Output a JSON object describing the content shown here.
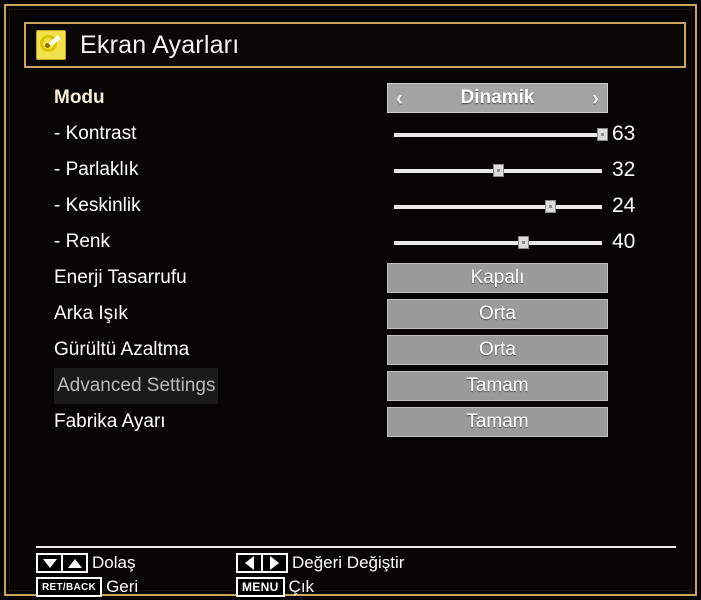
{
  "window": {
    "title": "Ekran Ayarları",
    "title_icon": "picture-settings-icon",
    "border_color": "#c9a45c",
    "background_color": "#070504"
  },
  "menu": {
    "rows": [
      {
        "label": "Modu",
        "control": "selector",
        "value": "Dinamik",
        "selected": true,
        "left_chevron": "‹",
        "right_chevron": "›",
        "name": "mode"
      },
      {
        "label": "- Kontrast",
        "control": "slider",
        "value": "63",
        "percent": 100,
        "sub": true,
        "name": "contrast"
      },
      {
        "label": "- Parlaklık",
        "control": "slider",
        "value": "32",
        "percent": 50,
        "sub": true,
        "name": "brightness"
      },
      {
        "label": "- Keskinlik",
        "control": "slider",
        "value": "24",
        "percent": 75,
        "sub": true,
        "name": "sharpness"
      },
      {
        "label": "- Renk",
        "control": "slider",
        "value": "40",
        "percent": 62,
        "sub": true,
        "name": "colour"
      },
      {
        "label": "Enerji Tasarrufu",
        "control": "button",
        "value": "Kapalı",
        "name": "power-saving"
      },
      {
        "label": "Arka Işık",
        "control": "button",
        "value": "Orta",
        "name": "backlight"
      },
      {
        "label": "Gürültü Azaltma",
        "control": "button",
        "value": "Orta",
        "name": "noise-reduction"
      },
      {
        "label": "Advanced Settings",
        "control": "button",
        "value": "Tamam",
        "disabled": true,
        "name": "advanced-settings"
      },
      {
        "label": "Fabrika Ayarı",
        "control": "button",
        "value": "Tamam",
        "name": "factory-reset"
      }
    ]
  },
  "hints": [
    {
      "key_type": "arrows-vertical",
      "label": "Dolaş",
      "name": "navigate"
    },
    {
      "key_type": "retback",
      "key_label": "RET/BACK",
      "label": "Geri",
      "name": "back"
    },
    {
      "key_type": "arrows-horizontal",
      "label": "Değeri Değiştir",
      "name": "change-value"
    },
    {
      "key_type": "menu",
      "key_label": "MENU",
      "label": "Çık",
      "name": "exit"
    }
  ]
}
